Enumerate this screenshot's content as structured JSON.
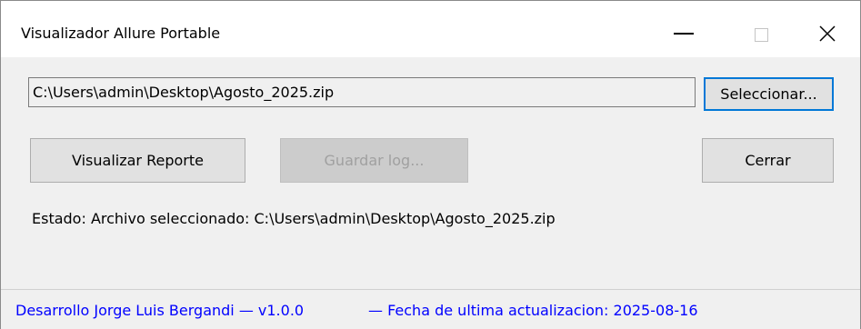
{
  "window": {
    "title": "Visualizador Allure Portable"
  },
  "file": {
    "path_value": "C:\\Users\\admin\\Desktop\\Agosto_2025.zip",
    "select_label": "Seleccionar..."
  },
  "actions": {
    "view_label": "Visualizar Reporte",
    "save_log_label": "Guardar log...",
    "close_label": "Cerrar"
  },
  "status": {
    "text": "Estado: Archivo seleccionado: C:\\Users\\admin\\Desktop\\Agosto_2025.zip"
  },
  "footer": {
    "author": "Desarrollo Jorge Luis Bergandi — v1.0.0",
    "last_update": "— Fecha de ultima actualizacion: 2025-08-16"
  },
  "colors": {
    "footer_text": "#0000ff",
    "default_button_border": "#0078d7",
    "window_background": "#f0f0f0"
  },
  "icons": {
    "minimize": "minimize-icon",
    "maximize": "maximize-icon",
    "close": "close-icon"
  }
}
